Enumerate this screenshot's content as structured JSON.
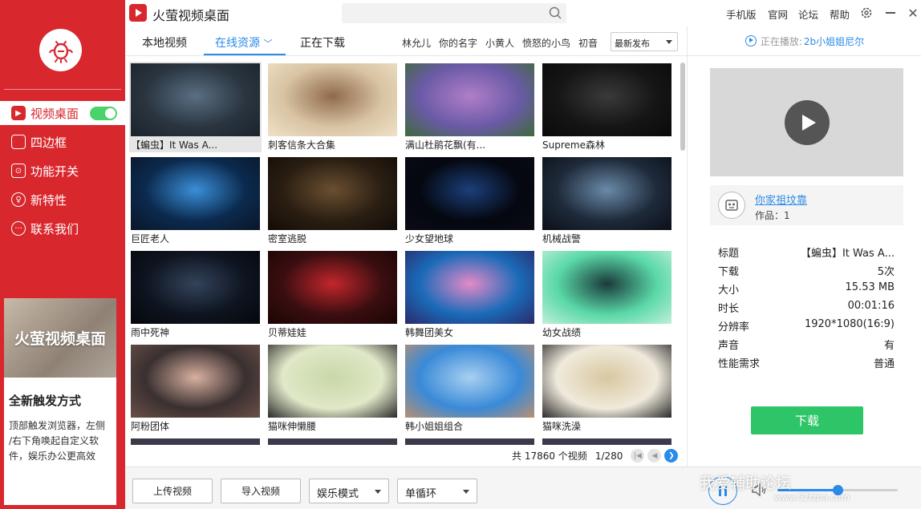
{
  "app": {
    "title": "火萤视频桌面"
  },
  "topbar": {
    "links": [
      "手机版",
      "官网",
      "论坛",
      "帮助"
    ]
  },
  "sidebar": {
    "items": [
      {
        "label": "视频桌面",
        "icon": "play-icon",
        "active": true,
        "toggle_on": true
      },
      {
        "label": "四边框",
        "icon": "frame-icon"
      },
      {
        "label": "功能开关",
        "icon": "switch-icon"
      },
      {
        "label": "新特性",
        "icon": "bulb-icon"
      },
      {
        "label": "联系我们",
        "icon": "chat-icon"
      }
    ],
    "promo": {
      "image_text": "火萤视频桌面",
      "heading": "全新触发方式",
      "lines": [
        "顶部触发浏览器，左侧",
        "/右下角唤起自定义软",
        "件，娱乐办公更高效"
      ]
    }
  },
  "tabs": {
    "items": [
      "本地视频",
      "在线资源",
      "正在下载"
    ],
    "active": 1,
    "tags": [
      "林允儿",
      "你的名字",
      "小黄人",
      "愤怒的小鸟",
      "初音"
    ],
    "sort": "最新发布"
  },
  "videos": [
    {
      "label": "【蝙虫】It Was A...",
      "colors": [
        "#2a3540",
        "#5a6f82",
        "#1b232c"
      ]
    },
    {
      "label": "刺客信条大合集",
      "colors": [
        "#d9c4a4",
        "#8f6a4a",
        "#efe1c8"
      ]
    },
    {
      "label": "满山杜鹃花飘(有...",
      "colors": [
        "#6a5aa6",
        "#b07ec8",
        "#3f6a3a"
      ]
    },
    {
      "label": "Supreme森林",
      "colors": [
        "#151515",
        "#3a3a3a",
        "#0a0a0a"
      ]
    },
    {
      "label": "巨匠老人",
      "colors": [
        "#0b2a4e",
        "#3a8fd8",
        "#0a1626"
      ]
    },
    {
      "label": "密室逃脱",
      "colors": [
        "#2a1e12",
        "#6a4f30",
        "#120c07"
      ]
    },
    {
      "label": "少女望地球",
      "colors": [
        "#050810",
        "#1b3f7a",
        "#0a0a14"
      ]
    },
    {
      "label": "机械战警",
      "colors": [
        "#1e2a3a",
        "#6a8aa8",
        "#0b0f18"
      ]
    },
    {
      "label": "雨中死神",
      "colors": [
        "#0e1420",
        "#33435a",
        "#05070c"
      ]
    },
    {
      "label": "贝蒂娃娃",
      "colors": [
        "#3a0e10",
        "#c2262c",
        "#1a0505"
      ]
    },
    {
      "label": "韩舞团美女",
      "colors": [
        "#1a6ab8",
        "#e48ac8",
        "#2a2a6a"
      ]
    },
    {
      "label": "幼女战绩",
      "colors": [
        "#5ad8a8",
        "#1a3a3a",
        "#bff0d8"
      ]
    },
    {
      "label": "阿粉团体",
      "colors": [
        "#3a3030",
        "#d8b0a0",
        "#6a5048"
      ]
    },
    {
      "label": "猫咪伸懒腰",
      "colors": [
        "#e0e8c8",
        "#c8d8a8",
        "#2a2a2a"
      ]
    },
    {
      "label": "韩小姐姐组合",
      "colors": [
        "#3a8ad8",
        "#a8d0f0",
        "#b89070"
      ]
    },
    {
      "label": "猫咪洗澡",
      "colors": [
        "#f0eadc",
        "#d8c8a0",
        "#2a2a2a"
      ]
    }
  ],
  "pager": {
    "total_text": "共 17860 个视频",
    "page_text": "1/280"
  },
  "right": {
    "now_playing_label": "正在播放:",
    "now_playing_title": "2b小姐姐尼尔",
    "author_name": "你家祖坟靠",
    "author_works": "作品：1",
    "info": [
      {
        "k": "标题",
        "v": "【蝙虫】It Was A..."
      },
      {
        "k": "下载",
        "v": "5次"
      },
      {
        "k": "大小",
        "v": "15.53 MB"
      },
      {
        "k": "时长",
        "v": "00:01:16"
      },
      {
        "k": "分辨率",
        "v": "1920*1080(16:9)"
      },
      {
        "k": "声音",
        "v": "有"
      },
      {
        "k": "性能需求",
        "v": "普通"
      }
    ],
    "download_label": "下载"
  },
  "bottom": {
    "upload": "上传视频",
    "import": "导入视频",
    "mode": "娱乐模式",
    "loop": "单循环",
    "volume": 0.5
  },
  "watermark": {
    "main": "我爱辅助论坛",
    "sub": "www.52fzba.com"
  }
}
